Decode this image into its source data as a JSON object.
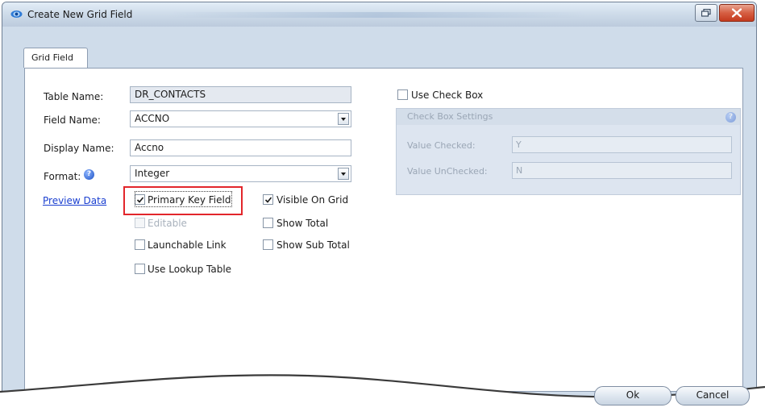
{
  "window": {
    "title": "Create New Grid Field"
  },
  "tab": {
    "label": "Grid Field"
  },
  "form": {
    "table_name": {
      "label": "Table Name:",
      "value": "DR_CONTACTS"
    },
    "field_name": {
      "label": "Field Name:",
      "value": "ACCNO"
    },
    "display_name": {
      "label": "Display Name:",
      "value": "Accno"
    },
    "format": {
      "label": "Format:",
      "value": "Integer"
    },
    "preview_link": "Preview Data"
  },
  "checkboxes": {
    "primary_key": {
      "label": "Primary Key Field",
      "checked": true
    },
    "editable": {
      "label": "Editable",
      "checked": false,
      "disabled": true
    },
    "launchable_link": {
      "label": "Launchable Link",
      "checked": false
    },
    "use_lookup_table": {
      "label": "Use Lookup Table",
      "checked": false
    },
    "visible_on_grid": {
      "label": "Visible On Grid",
      "checked": true
    },
    "show_total": {
      "label": "Show Total",
      "checked": false
    },
    "show_sub_total": {
      "label": "Show Sub Total",
      "checked": false
    },
    "use_check_box": {
      "label": "Use Check Box",
      "checked": false
    }
  },
  "check_box_settings": {
    "title": "Check Box Settings",
    "value_checked": {
      "label": "Value Checked:",
      "value": "Y"
    },
    "value_unchecked": {
      "label": "Value UnChecked:",
      "value": "N"
    }
  },
  "buttons": {
    "ok": "Ok",
    "cancel": "Cancel"
  },
  "colors": {
    "highlight": "#e2262b",
    "link": "#1a3fd0",
    "close_button": "#c43a1e"
  }
}
